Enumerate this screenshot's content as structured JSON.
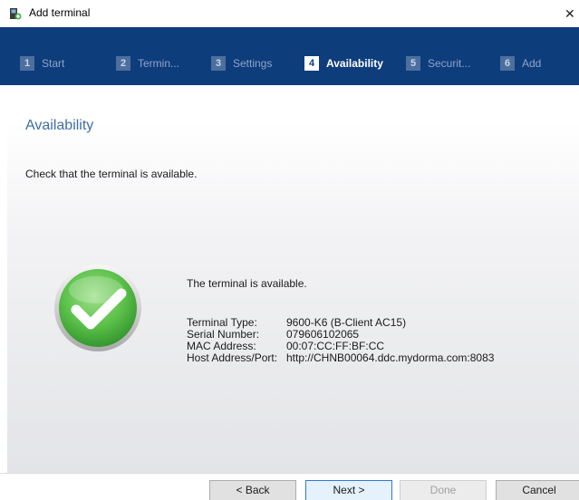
{
  "window": {
    "title": "Add terminal",
    "close_glyph": "✕"
  },
  "steps": [
    {
      "number": "1",
      "label": "Start",
      "active": false
    },
    {
      "number": "2",
      "label": "Termin...",
      "active": false
    },
    {
      "number": "3",
      "label": "Settings",
      "active": false
    },
    {
      "number": "4",
      "label": "Availability",
      "active": true
    },
    {
      "number": "5",
      "label": "Securit...",
      "active": false
    },
    {
      "number": "6",
      "label": "Add",
      "active": false
    }
  ],
  "page": {
    "title": "Availability",
    "instruction": "Check that the terminal is available.",
    "status_icon": "check-circle-icon",
    "status": "The terminal is available."
  },
  "details": [
    {
      "key": "Terminal Type:",
      "value": "9600-K6 (B-Client AC15)"
    },
    {
      "key": "Serial Number:",
      "value": "079606102065"
    },
    {
      "key": "MAC Address:",
      "value": "00:07:CC:FF:BF:CC"
    },
    {
      "key": "Host Address/Port:",
      "value": "http://CHNB00064.ddc.mydorma.com:8083"
    }
  ],
  "buttons": {
    "back": "< Back",
    "next": "Next >",
    "done": "Done",
    "cancel": "Cancel"
  },
  "colors": {
    "header": "#0e3d7c",
    "accent": "#3e6fa4",
    "success": "#58c04a"
  }
}
